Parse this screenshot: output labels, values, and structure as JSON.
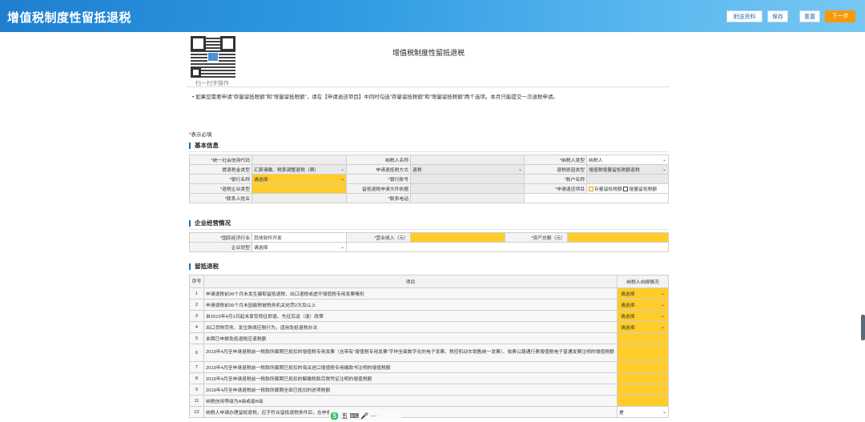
{
  "app_title": "增值税制度性留抵退税",
  "toolbar": {
    "attach_label": "附送资料",
    "save_label": "保存",
    "reset_label": "重置",
    "next_label": "下一步"
  },
  "qr_caption": "扫一扫字操作",
  "page_title": "增值税制度性留抵退税",
  "notice": "• 如果您需要申请“存量留抵税额”和“增量留抵税额”，请在【申请退还项目】中同时勾选“存量留抵税额”和“增量留抵税额”两个选项。本月只能提交一次退税申请。",
  "required_star": "*",
  "required_text": "表示必填",
  "section1": "基本信息",
  "basic": {
    "uscc_label": "统一社会信用代码",
    "taxpayer_name_label": "纳税人名称",
    "taxpayer_type_label": "纳税人类型",
    "taxpayer_type_value": "纳税人",
    "tax_reason_label": "提退税金类型",
    "tax_reason_value": "汇算清缴、税率调整退税（费）",
    "apply_method_label": "申请退抵税方式",
    "apply_method_value": "退税",
    "refund_reason_label": "退税原因类型",
    "refund_reason_value": "增值税增量留抵税额退税",
    "bank_name_label": "银行名称",
    "bank_name_value": "请选择",
    "bank_account_label": "银行账号",
    "account_name_label": "账户名称",
    "enterprise_type_label": "退税企业类型",
    "doc_basis_label": "留抵退税申请文件依据",
    "refund_item_label": "申请退还项目",
    "opt_stock": "存量留抵税额",
    "opt_incr": "增量留抵税额",
    "contact_name_label": "联系人姓名",
    "contact_phone_label": "联系电话"
  },
  "section2": "企业经营情况",
  "ops": {
    "industry_label": "国民经济行业",
    "industry_value": "其他软件开发",
    "revenue_label": "营业收入（元）",
    "assets_label": "资产总额（元）",
    "scale_label": "企业划型",
    "scale_value": "请选择"
  },
  "section3": "留抵退税",
  "refund_table": {
    "col_no": "序号",
    "col_item": "项目",
    "col_status": "纳税人自报情况",
    "rows": [
      {
        "no": "1",
        "item": "申请退税前36个月未发生骗取留抵退税、出口退税或虚开增值税专用发票情形",
        "value": "请选择"
      },
      {
        "no": "2",
        "item": "申请退税前36个月未因偷税被税务机关处罚2次及以上",
        "value": "请选择"
      },
      {
        "no": "3",
        "item": "自2019年4月1日起未享受即征即退、先征后返（退）政策",
        "value": "请选择"
      },
      {
        "no": "4",
        "item": "出口货物劳务、发生跨境应税行为，适用免抵退税办法",
        "value": "请选择"
      },
      {
        "no": "5",
        "item": "本期已申报免抵退税应退税额",
        "value": ""
      },
      {
        "no": "6",
        "item": "2019年4月至申请退税前一税款所属期已抵扣的增值税专用发票（含带有“增值税专用发票”字样全面数字化的电子发票、税控机动车销售统一发票）、收费公路通行费增值税电子普通发票注明的增值税额",
        "value": ""
      },
      {
        "no": "7",
        "item": "2019年4月至申请退税前一税款所属期已抵扣的海关进口增值税专用缴款书注明的增值税额",
        "value": ""
      },
      {
        "no": "8",
        "item": "2019年4月至申请退税前一税款所属期已抵扣的解缴税款完税凭证注明的增值税额",
        "value": ""
      },
      {
        "no": "9",
        "item": "2019年4月至申请退税前一税款所属期全部已抵扣的进项税额",
        "value": ""
      },
      {
        "no": "11",
        "item": "纳税信用等级为A级或者B级",
        "value": ""
      },
      {
        "no": "12",
        "item": "纳税人申请办理留抵退税，应于符合留抵退税条件后，在申报期内，且完成本期增值税纳税申报",
        "value": "是"
      }
    ]
  },
  "ime": {
    "logo": "S",
    "text": "五 ⌨ 🎤 ⋯"
  }
}
